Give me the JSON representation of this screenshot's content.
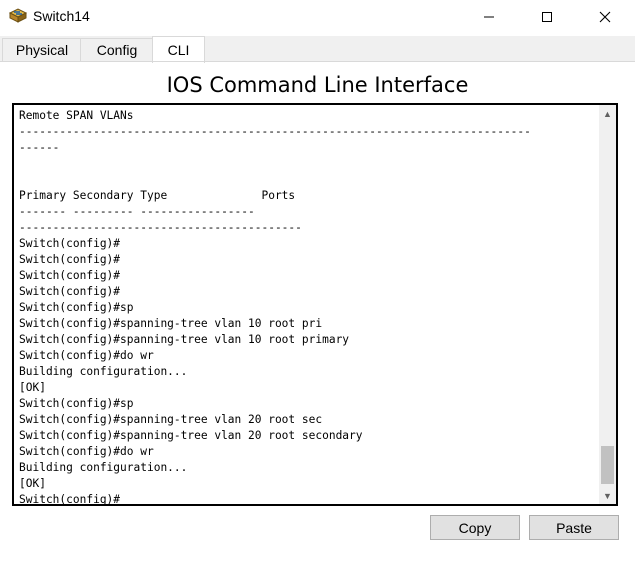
{
  "window": {
    "title": "Switch14",
    "icon": "switch-device-icon",
    "controls": {
      "minimize": "─",
      "maximize": "☐",
      "close": "✕"
    }
  },
  "tabs": [
    {
      "label": "Physical",
      "active": false
    },
    {
      "label": "Config",
      "active": false
    },
    {
      "label": "CLI",
      "active": true
    }
  ],
  "heading": "IOS Command Line Interface",
  "terminal": {
    "lines": [
      "Remote SPAN VLANs",
      "----------------------------------------------------------------------------",
      "------",
      "",
      "",
      "Primary Secondary Type              Ports",
      "------- --------- -----------------",
      "------------------------------------------",
      "Switch(config)#",
      "Switch(config)#",
      "Switch(config)#",
      "Switch(config)#",
      "Switch(config)#sp",
      "Switch(config)#spanning-tree vlan 10 root pri",
      "Switch(config)#spanning-tree vlan 10 root primary",
      "Switch(config)#do wr",
      "Building configuration...",
      "[OK]",
      "Switch(config)#sp",
      "Switch(config)#spanning-tree vlan 20 root sec",
      "Switch(config)#spanning-tree vlan 20 root secondary",
      "Switch(config)#do wr",
      "Building configuration...",
      "[OK]",
      "Switch(config)#"
    ]
  },
  "buttons": {
    "copy": "Copy",
    "paste": "Paste"
  },
  "colors": {
    "tabstrip": "#f0f0f0",
    "button": "#e1e1e1",
    "scroll_thumb": "#c1c1c1"
  }
}
